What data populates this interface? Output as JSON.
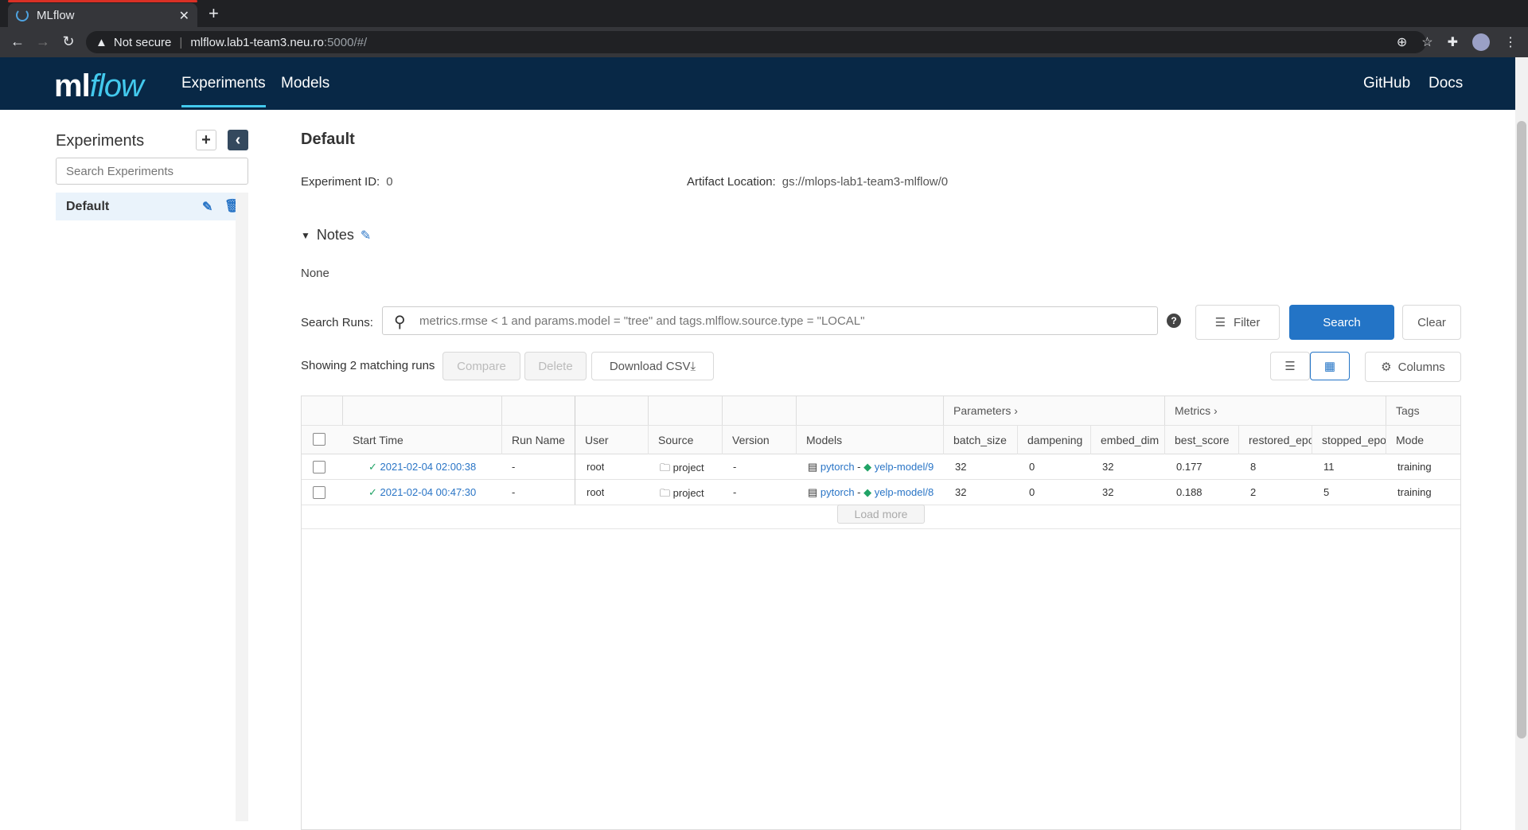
{
  "browser": {
    "tab_title": "MLflow",
    "url_warning": "Not secure",
    "url_host": "mlflow.lab1-team3.neu.ro",
    "url_path": ":5000/#/"
  },
  "header": {
    "logo_ml": "ml",
    "logo_flow": "flow",
    "nav": [
      "Experiments",
      "Models"
    ],
    "links": [
      "GitHub",
      "Docs"
    ]
  },
  "sidebar": {
    "title": "Experiments",
    "search_placeholder": "Search Experiments",
    "items": [
      {
        "label": "Default"
      }
    ]
  },
  "main": {
    "title": "Default",
    "experiment_id_label": "Experiment ID:",
    "experiment_id": "0",
    "artifact_label": "Artifact Location:",
    "artifact_location": "gs://mlops-lab1-team3-mlflow/0",
    "notes_label": "Notes",
    "notes_body": "None",
    "search_label": "Search Runs:",
    "search_placeholder": "metrics.rmse < 1 and params.model = \"tree\" and tags.mlflow.source.type = \"LOCAL\"",
    "filter_label": "Filter",
    "search_button": "Search",
    "clear_button": "Clear",
    "showing_text": "Showing 2 matching runs",
    "compare_button": "Compare",
    "delete_button": "Delete",
    "download_button": "Download CSV",
    "columns_button": "Columns"
  },
  "table": {
    "groups": {
      "parameters": "Parameters",
      "metrics": "Metrics",
      "tags": "Tags"
    },
    "columns": [
      "Start Time",
      "Run Name",
      "User",
      "Source",
      "Version",
      "Models",
      "batch_size",
      "dampening",
      "embed_dim",
      "best_score",
      "restored_epo",
      "stopped_epo",
      "Mode"
    ],
    "rows": [
      {
        "start_time": "2021-02-04 02:00:38",
        "run_name": "-",
        "user": "root",
        "source": "project",
        "version": "-",
        "model_flavor": "pytorch",
        "model_name": "yelp-model/9",
        "batch_size": "32",
        "dampening": "0",
        "embed_dim": "32",
        "best_score": "0.177",
        "restored_epoch": "8",
        "stopped_epoch": "11",
        "mode": "training"
      },
      {
        "start_time": "2021-02-04 00:47:30",
        "run_name": "-",
        "user": "root",
        "source": "project",
        "version": "-",
        "model_flavor": "pytorch",
        "model_name": "yelp-model/8",
        "batch_size": "32",
        "dampening": "0",
        "embed_dim": "32",
        "best_score": "0.188",
        "restored_epoch": "2",
        "stopped_epoch": "5",
        "mode": "training"
      }
    ],
    "load_more": "Load more"
  }
}
